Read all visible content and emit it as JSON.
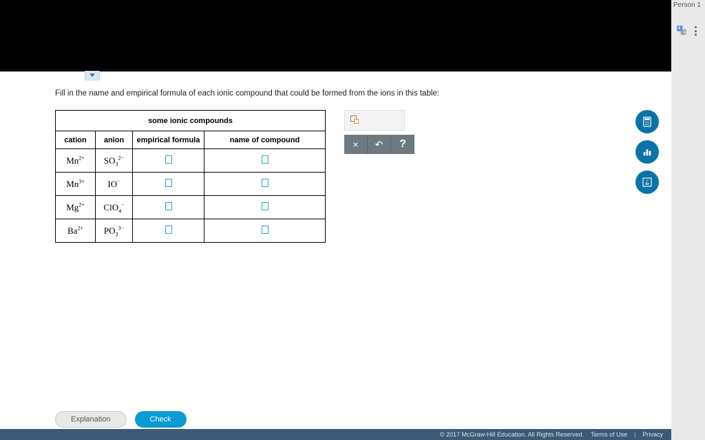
{
  "profile": {
    "name": "Person 1"
  },
  "instruction": "Fill in the name and empirical formula of each ionic compound that could be formed from the ions in this table:",
  "table": {
    "title": "some ionic compounds",
    "headers": {
      "cation": "cation",
      "anion": "anion",
      "formula": "empirical formula",
      "name": "name of compound"
    },
    "rows": [
      {
        "cation_base": "Mn",
        "cation_charge": "2+",
        "anion_base": "SO",
        "anion_sub": "3",
        "anion_charge": "2−"
      },
      {
        "cation_base": "Mn",
        "cation_charge": "3+",
        "anion_base": "IO",
        "anion_sub": "",
        "anion_charge": "−"
      },
      {
        "cation_base": "Mg",
        "cation_charge": "2+",
        "anion_base": "ClO",
        "anion_sub": "4",
        "anion_charge": "−"
      },
      {
        "cation_base": "Ba",
        "cation_charge": "2+",
        "anion_base": "PO",
        "anion_sub": "3",
        "anion_charge": "3−"
      }
    ]
  },
  "toolbar": {
    "close": "×",
    "undo": "↶",
    "help": "?"
  },
  "side_tools": {
    "calculator": "calculator",
    "stats": "stats",
    "periodic": "Ar"
  },
  "bottom": {
    "explanation": "Explanation",
    "check": "Check"
  },
  "footer": {
    "copyright": "© 2017 McGraw-Hill Education. All Rights Reserved.",
    "terms": "Terms of Use",
    "privacy": "Privacy"
  }
}
